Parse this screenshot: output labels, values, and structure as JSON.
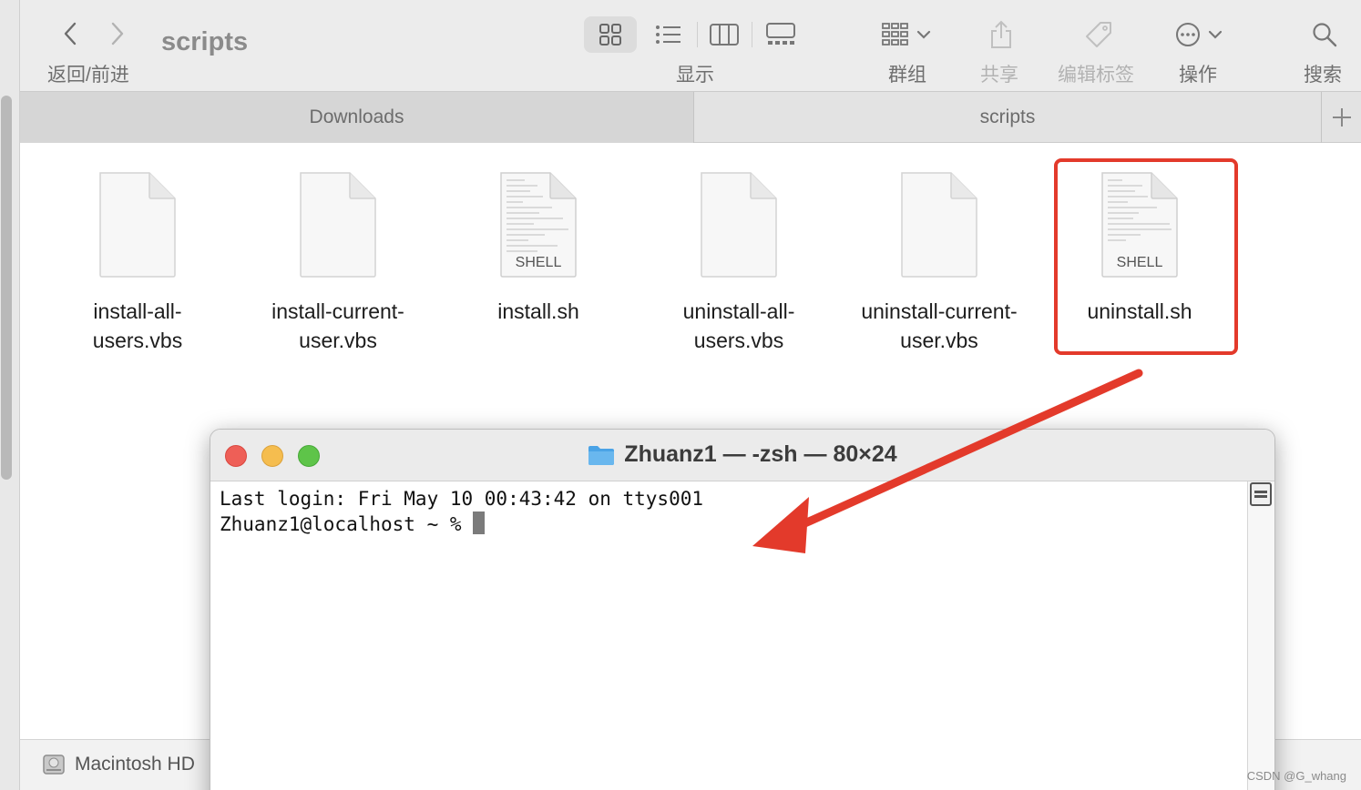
{
  "toolbar": {
    "title": "scripts",
    "nav_label": "返回/前进",
    "view_label": "显示",
    "group_label": "群组",
    "share_label": "共享",
    "tags_label": "编辑标签",
    "action_label": "操作",
    "search_label": "搜索"
  },
  "tabs": [
    {
      "label": "Downloads"
    },
    {
      "label": "scripts"
    }
  ],
  "files": [
    {
      "name": "install-all-users.vbs",
      "line1": "install-all-",
      "line2": "users.vbs",
      "kind": ""
    },
    {
      "name": "install-current-user.vbs",
      "line1": "install-current-",
      "line2": "user.vbs",
      "kind": ""
    },
    {
      "name": "install.sh",
      "line1": "install.sh",
      "line2": "",
      "kind": "SHELL"
    },
    {
      "name": "uninstall-all-users.vbs",
      "line1": "uninstall-all-",
      "line2": "users.vbs",
      "kind": ""
    },
    {
      "name": "uninstall-current-user.vbs",
      "line1": "uninstall-current-",
      "line2": "user.vbs",
      "kind": ""
    },
    {
      "name": "uninstall.sh",
      "line1": "uninstall.sh",
      "line2": "",
      "kind": "SHELL"
    }
  ],
  "status": {
    "disk": "Macintosh HD"
  },
  "terminal": {
    "title": "Zhuanz1 — -zsh — 80×24",
    "line1": "Last login: Fri May 10 00:43:42 on ttys001",
    "prompt": "Zhuanz1@localhost ~ % "
  },
  "watermark": "CSDN @G_whang",
  "colors": {
    "highlight": "#e33a2b",
    "close": "#ee5f57",
    "minimize": "#f5bd4f",
    "zoom": "#5ec449",
    "folder": "#4aa3e6"
  }
}
